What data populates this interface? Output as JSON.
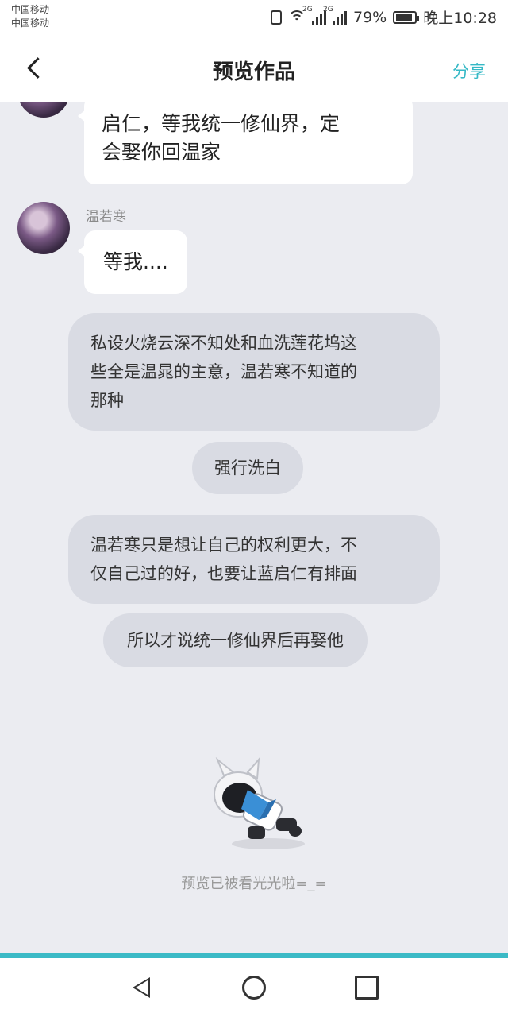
{
  "status_bar": {
    "carrier_1": "中国移动",
    "carrier_2": "中国移动",
    "signal_tag_1": "2G",
    "signal_tag_2": "2G",
    "battery": "79%",
    "time": "晚上10:28"
  },
  "header": {
    "title": "预览作品",
    "share_label": "分享"
  },
  "messages": [
    {
      "type": "character",
      "text_line_1": "启仁，等我统一修仙界，定",
      "text_line_2": "会娶你回温家"
    },
    {
      "type": "character",
      "sender": "温若寒",
      "text": "等我...."
    },
    {
      "type": "narration",
      "lines": [
        "私设火烧云深不知处和血洗莲花坞这",
        "些全是温晁的主意，温若寒不知道的",
        "那种"
      ]
    },
    {
      "type": "narration",
      "text": "强行洗白"
    },
    {
      "type": "narration",
      "lines": [
        "温若寒只是想让自己的权利更大，不",
        "仅自己过的好，也要让蓝启仁有排面"
      ]
    },
    {
      "type": "narration",
      "text": "所以才说统一修仙界后再娶他"
    }
  ],
  "end_notice": "预览已被看光光啦=_=",
  "colors": {
    "accent": "#3bbac6",
    "share": "#36b9c6",
    "narration_bg": "#d9dbe3",
    "page_bg": "#ebecf1"
  }
}
